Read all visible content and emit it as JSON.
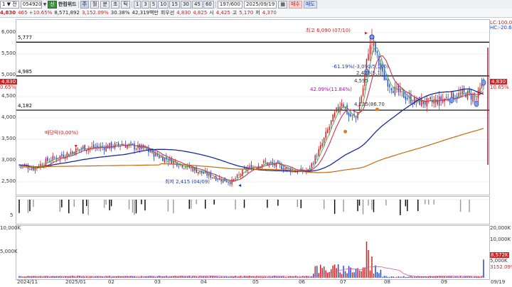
{
  "toolbar": {
    "code_prefix": "1 ▼ 전",
    "code": "054920",
    "change_row": "465 +10.65%",
    "price_small": "4,830",
    "search_badge": "신",
    "stock_name": "한컴위드",
    "btn_day": "주",
    "btn_week": "월",
    "btn_month": "분",
    "btn_min": "초",
    "btn_tick": "틱",
    "periods": [
      "1",
      "3",
      "5",
      "10",
      "15",
      "30",
      "45",
      "60"
    ],
    "volume": "8,571,892",
    "volume_ratio": "3,152.09%",
    "turnover_ratio": "30.38%",
    "amount": "42,319백만",
    "pref_label": "회우선",
    "open_label": "시",
    "high_label": "고",
    "low_label": "저",
    "bid": "4,830",
    "ask": "4,825",
    "open": "4,425",
    "high": "5,170",
    "low": "4,370",
    "count": "197/600",
    "date": "2025/09/19",
    "buy_label": "매수",
    "sell_label": "매도"
  },
  "price_axis": {
    "left_ticks": [
      "6,000",
      "5,500",
      "5,000",
      "4,500",
      "4,000",
      "3,500",
      "3,000",
      "2,500"
    ],
    "hlines": [
      "5,777",
      "4,985",
      "4,182"
    ],
    "current": "4,830",
    "current_pct": "0.65%",
    "right_current": "4,830",
    "right_pct": "10.65%",
    "right_top": "LC:100.00",
    "right_top2": "HC:-20.65"
  },
  "annotations": {
    "high": "최고 6,090 (07/10)",
    "low": "최저 2,415 (04/09)",
    "dividend": "배당락(0.00%)",
    "pct1": "-61.19%(-3,090/5,180)",
    "pct2": "42.09%(11.84%)",
    "pct3": "4,235(86.70",
    "mid1": "2,423(5,1",
    "mid2": "4,595"
  },
  "indicator_axis": {
    "tick5": "5",
    "tick_blank": ""
  },
  "volume_axis": {
    "left_ticks": [
      "10,000K",
      "5,000K"
    ],
    "right_ticks": [
      "20,000K",
      "10,000K",
      "5,000K"
    ],
    "right_cur": "8,572K",
    "right_pct1": "152.09%",
    "right_pct2": "3152.09%"
  },
  "xaxis": [
    "2024/11",
    "2025/01",
    "02",
    "03",
    "04",
    "05",
    "06",
    "07",
    "08",
    "09",
    "09/19"
  ],
  "colors": {
    "up": "#d62020",
    "down": "#1f48d8",
    "ma5": "#cc3355",
    "ma20": "#1a2a9e",
    "ma60": "#c66a10",
    "ma120": "#9a9a9a",
    "hline": "#000000"
  }
}
